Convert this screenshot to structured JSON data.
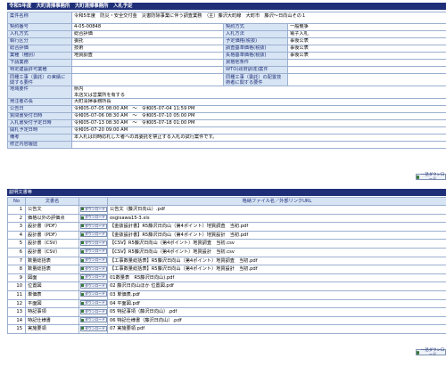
{
  "header": {
    "title": "令和5年度　大町清掃事務所　大町清掃事務所　入札予定"
  },
  "info": {
    "rows": [
      {
        "l1": "案件名称",
        "v1": "令和5年度　防災・安全交付金　災害防除事業に伴う調査業務　（主）藤沢大町線　大町市　藤沢～日向山その１",
        "span": true,
        "multi": true
      },
      {
        "l1": "契約番号",
        "v1": "4-05-00848",
        "l2": "契約方式",
        "v2": "一般競争"
      },
      {
        "l1": "入札方式",
        "v1": "総合評価",
        "l2": "入札方法",
        "v2": "電子入札"
      },
      {
        "l1": "執行区分",
        "v1": "委託",
        "l2": "予定価格(税抜)",
        "v2": "事後公表"
      },
      {
        "l1": "総合評価",
        "v1": "技術",
        "l2": "調査基準価格(税抜)",
        "v2": "事後公表"
      },
      {
        "l1": "業種（種別）",
        "v1": "地質調査",
        "l2": "失格基準価格(税抜)",
        "v2": "事後公表"
      },
      {
        "l1": "下請業務",
        "v1": "",
        "l2": "資格他条件",
        "v2": ""
      },
      {
        "l1": "特定建設許可業種",
        "v1": "",
        "l2": "WTO(政府調達)案件",
        "v2": ""
      },
      {
        "l1": "同種工事（委託）の実績に関する要件",
        "v1": "",
        "l2": "同種工事（委託）の配置技術者に関する要件",
        "v2": "",
        "multi": true
      },
      {
        "l1": "地域要件",
        "v1": "県内\n本店又は営業所を有する",
        "span": true,
        "multi": true
      },
      {
        "l1": "発注者の長",
        "v1": "大町清掃事務所長",
        "span": true
      },
      {
        "l1": "公告日",
        "v1": "令和05-07-05 08:00 AM　～　令和05-07-04 11:59 PM",
        "span": true
      },
      {
        "l1": "質問書受付日時",
        "v1": "令和05-07-06 08:30 AM　～　令和05-07-10 05:00 PM",
        "span": true
      },
      {
        "l1": "入札書受付予定日時",
        "v1": "令和05-07-13 08:30 AM　～　令和05-07-18 01:00 PM",
        "span": true
      },
      {
        "l1": "開札予定日時",
        "v1": "令和05-07-20 09:00 AM",
        "span": true
      },
      {
        "l1": "備考",
        "v1": "本入札は同時応札した者への再委託を禁止する入札の試行案件です。",
        "span": true
      },
      {
        "l1": "修正内容履歴",
        "v1": "",
        "span": true
      }
    ]
  },
  "download_all_label": "一括ダウンロード",
  "docs_section": {
    "title": "説明文書等"
  },
  "docs": {
    "headers": {
      "no": "No",
      "name": "文書名",
      "file": "格納ファイル名／外部リンクURL"
    },
    "download_label": "ダウンロード",
    "rows": [
      {
        "no": "1",
        "name": "公告文",
        "file": "公告文（藤沢日向山）.pdf"
      },
      {
        "no": "2",
        "name": "価格以外の評価点",
        "file": "osgisawa15-3.xls"
      },
      {
        "no": "3",
        "name": "設計書（PDF）",
        "file": "【金抜設計書】R5藤沢日向山（第4ポイント）地質調査　当初.pdf"
      },
      {
        "no": "4",
        "name": "設計書（PDF）",
        "file": "【金抜設計書】R5藤沢日向山（第4ポイント）地質設計　当初.pdf"
      },
      {
        "no": "5",
        "name": "設計書（CSV）",
        "file": "【CSV】R5藤沢日向山（第4ポイント）地質調査　当初.csv"
      },
      {
        "no": "6",
        "name": "設計書（CSV）",
        "file": "【CSV】R5藤沢日向山（第4ポイント）地質設計　当初.csv"
      },
      {
        "no": "7",
        "name": "数量総括表",
        "file": "【工事数量総括表】R5藤沢日向山（第4ポイント）地質調査　当初.pdf"
      },
      {
        "no": "8",
        "name": "数量総括表",
        "file": "【工事数量総括表】R5藤沢日向山（第4ポイント）地質設計　当初.pdf"
      },
      {
        "no": "9",
        "name": "図面",
        "file": "01数量表　R5藤沢日向山).pdf"
      },
      {
        "no": "10",
        "name": "位置図",
        "file": "02 藤沢日向山ほか 位置図.pdf"
      },
      {
        "no": "11",
        "name": "単価表",
        "file": "03 単価表.pdf"
      },
      {
        "no": "12",
        "name": "平面図",
        "file": "04 平面図.pdf"
      },
      {
        "no": "13",
        "name": "特記事項",
        "file": "05 特記事項（藤沢日向山）.pdf"
      },
      {
        "no": "14",
        "name": "特記仕様書",
        "file": "06 特記仕様書（藤沢日向山）.pdf"
      },
      {
        "no": "15",
        "name": "実施要領",
        "file": "07 実施要領.pdf"
      }
    ]
  },
  "colors": {
    "header_bg": "#1e2f78",
    "label_bg": "#d7e4f4",
    "border": "#9bb0cf"
  }
}
